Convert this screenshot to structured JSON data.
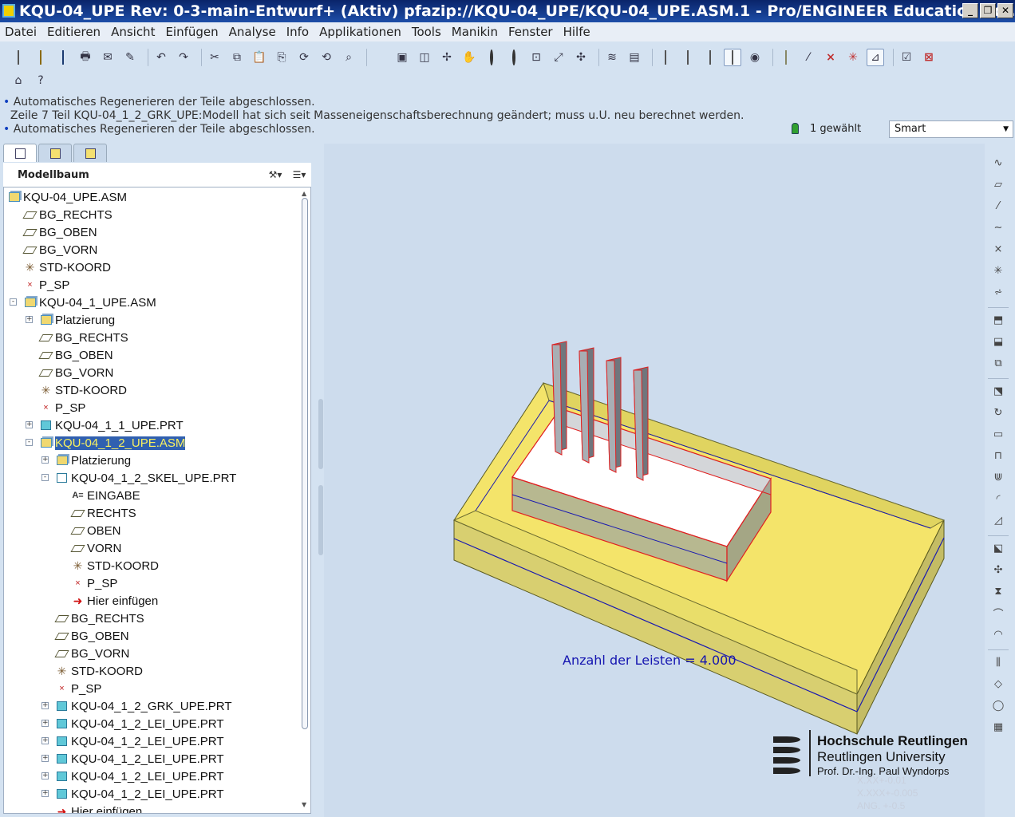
{
  "window": {
    "title": "KQU-04_UPE Rev: 0-3-main-Entwurf+ (Aktiv) pfazip://KQU-04_UPE/KQU-04_UPE.ASM.1 - Pro/ENGINEER Education Edi...",
    "buttons": {
      "minimize": "_",
      "restore": "❐",
      "close": "✕"
    }
  },
  "menu": [
    "Datei",
    "Editieren",
    "Ansicht",
    "Einfügen",
    "Analyse",
    "Info",
    "Applikationen",
    "Tools",
    "Manikin",
    "Fenster",
    "Hilfe"
  ],
  "toolbar": {
    "row1": [
      "new-file-icon",
      "open-folder-icon",
      "save-icon",
      "print-icon",
      "send-icon",
      "edit-icon",
      "sep",
      "undo-icon",
      "redo-icon",
      "sep",
      "cut-icon",
      "copy-icon",
      "paste-icon",
      "paste-special-icon",
      "regenerate-icon",
      "regen-manager-icon",
      "find-icon",
      "sep",
      "appearance-icon",
      "saved-views-icon",
      "sketch-view-icon",
      "layers-icon",
      "pan-icon",
      "zoom-in-icon",
      "zoom-out-icon",
      "refit-icon",
      "reorient-icon",
      "spin-center-icon",
      "sep",
      "layer-tree-icon",
      "view-manager-icon",
      "sep",
      "wireframe-icon",
      "hidden-line-icon",
      "no-hidden-icon",
      "shading-icon",
      "model-display-icon",
      "sep",
      "datum-planes-icon",
      "datum-axes-icon",
      "datum-points-icon",
      "csys-icon",
      "annotations-icon",
      "sep",
      "verify-icon",
      "close-window-icon"
    ],
    "row2": [
      "home-icon",
      "help-icon"
    ]
  },
  "messages": [
    {
      "bullet": true,
      "text": "Automatisches Regenerieren der Teile abgeschlossen."
    },
    {
      "bullet": false,
      "text": "Zeile 7 Teil KQU-04_1_2_GRK_UPE:Modell hat sich seit Masseneigenschaftsberechnung geändert; muss u.U. neu berechnet werden."
    },
    {
      "bullet": true,
      "text": "Automatisches Regenerieren der Teile abgeschlossen."
    }
  ],
  "status": {
    "selected": "1 gewählt",
    "filter": "Smart"
  },
  "panel": {
    "title": "Modellbaum"
  },
  "tree": [
    {
      "level": 0,
      "icon": "asm",
      "label": "KQU-04_UPE.ASM",
      "expander": ""
    },
    {
      "level": 1,
      "icon": "dtm",
      "label": "BG_RECHTS",
      "expander": ""
    },
    {
      "level": 1,
      "icon": "dtm",
      "label": "BG_OBEN",
      "expander": ""
    },
    {
      "level": 1,
      "icon": "dtm",
      "label": "BG_VORN",
      "expander": ""
    },
    {
      "level": 1,
      "icon": "csys",
      "label": "STD-KOORD",
      "expander": ""
    },
    {
      "level": 1,
      "icon": "pt",
      "label": "P_SP",
      "expander": ""
    },
    {
      "level": 1,
      "icon": "asm",
      "label": "KQU-04_1_UPE.ASM",
      "expander": "-"
    },
    {
      "level": 2,
      "icon": "asm",
      "label": "Platzierung",
      "expander": "+"
    },
    {
      "level": 2,
      "icon": "dtm",
      "label": "BG_RECHTS",
      "expander": ""
    },
    {
      "level": 2,
      "icon": "dtm",
      "label": "BG_OBEN",
      "expander": ""
    },
    {
      "level": 2,
      "icon": "dtm",
      "label": "BG_VORN",
      "expander": ""
    },
    {
      "level": 2,
      "icon": "csys",
      "label": "STD-KOORD",
      "expander": ""
    },
    {
      "level": 2,
      "icon": "pt",
      "label": "P_SP",
      "expander": ""
    },
    {
      "level": 2,
      "icon": "prt",
      "label": "KQU-04_1_1_UPE.PRT",
      "expander": "+"
    },
    {
      "level": 2,
      "icon": "asm",
      "label": "KQU-04_1_2_UPE.ASM",
      "expander": "-",
      "selected": true
    },
    {
      "level": 3,
      "icon": "asm",
      "label": "Platzierung",
      "expander": "+"
    },
    {
      "level": 3,
      "icon": "skel",
      "label": "KQU-04_1_2_SKEL_UPE.PRT",
      "expander": "-"
    },
    {
      "level": 4,
      "icon": "feat",
      "label": "EINGABE",
      "expander": ""
    },
    {
      "level": 4,
      "icon": "dtm",
      "label": "RECHTS",
      "expander": ""
    },
    {
      "level": 4,
      "icon": "dtm",
      "label": "OBEN",
      "expander": ""
    },
    {
      "level": 4,
      "icon": "dtm",
      "label": "VORN",
      "expander": ""
    },
    {
      "level": 4,
      "icon": "csys",
      "label": "STD-KOORD",
      "expander": ""
    },
    {
      "level": 4,
      "icon": "pt",
      "label": "P_SP",
      "expander": ""
    },
    {
      "level": 4,
      "icon": "ins",
      "label": "Hier einfügen",
      "expander": ""
    },
    {
      "level": 3,
      "icon": "dtm",
      "label": "BG_RECHTS",
      "expander": ""
    },
    {
      "level": 3,
      "icon": "dtm",
      "label": "BG_OBEN",
      "expander": ""
    },
    {
      "level": 3,
      "icon": "dtm",
      "label": "BG_VORN",
      "expander": ""
    },
    {
      "level": 3,
      "icon": "csys",
      "label": "STD-KOORD",
      "expander": ""
    },
    {
      "level": 3,
      "icon": "pt",
      "label": "P_SP",
      "expander": ""
    },
    {
      "level": 3,
      "icon": "prt",
      "label": "KQU-04_1_2_GRK_UPE.PRT",
      "expander": "+"
    },
    {
      "level": 3,
      "icon": "prt",
      "label": "KQU-04_1_2_LEI_UPE.PRT",
      "expander": "+"
    },
    {
      "level": 3,
      "icon": "prt",
      "label": "KQU-04_1_2_LEI_UPE.PRT",
      "expander": "+"
    },
    {
      "level": 3,
      "icon": "prt",
      "label": "KQU-04_1_2_LEI_UPE.PRT",
      "expander": "+"
    },
    {
      "level": 3,
      "icon": "prt",
      "label": "KQU-04_1_2_LEI_UPE.PRT",
      "expander": "+"
    },
    {
      "level": 3,
      "icon": "prt",
      "label": "KQU-04_1_2_LEI_UPE.PRT",
      "expander": "+"
    },
    {
      "level": 3,
      "icon": "ins",
      "label": "Hier einfügen",
      "expander": ""
    }
  ],
  "viewport": {
    "parameter_note": "Anzahl der Leisten =  4.000",
    "logo": {
      "line1": "Hochschule Reutlingen",
      "line2": "Reutlingen University",
      "line3": "Prof. Dr.-Ing. Paul Wyndorps"
    },
    "faint_text": [
      "X.XX+-0.01",
      "X.XXX+-0.005",
      "ANG. +-0.5"
    ],
    "colors": {
      "base_plate": "#f4e46a",
      "highlight": "#e02020",
      "edge": "#1a1ab0"
    }
  },
  "rightbar": [
    "sketch-tool-icon",
    "datum-plane-tool-icon",
    "datum-axis-tool-icon",
    "datum-curve-icon",
    "datum-point-icon",
    "datum-csys-icon",
    "analysis-feature-icon",
    "sep",
    "insert-component-icon",
    "assembly-component-icon",
    "component-operations-icon",
    "sep",
    "extrude-icon",
    "revolve-icon",
    "create-part-icon",
    "sweep-icon",
    "blend-icon",
    "round-icon",
    "chamfer-icon",
    "sep",
    "shell-icon",
    "pattern-icon",
    "mirror-icon",
    "warp-icon",
    "flange-icon",
    "sep",
    "rib-icon",
    "draft-icon",
    "hole-icon",
    "calc-icon"
  ]
}
